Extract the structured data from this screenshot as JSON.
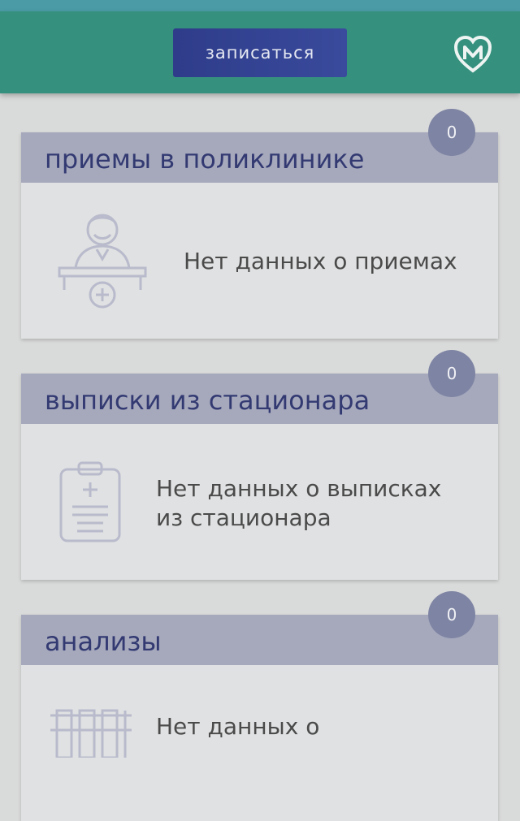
{
  "header": {
    "signup_label": "записаться",
    "logo_icon": "heart-m-logo-icon"
  },
  "cards": [
    {
      "title": "приемы в поликлинике",
      "count": "0",
      "empty_text": "Нет данных о приемах",
      "icon": "receptionist-desk-icon"
    },
    {
      "title": "выписки из стационара",
      "count": "0",
      "empty_text_line1": "Нет данных о выписках",
      "empty_text_line2": "из стационара",
      "icon": "clipboard-icon"
    },
    {
      "title": "анализы",
      "count": "0",
      "empty_text_line1": "Нет данных о",
      "icon": "test-tubes-icon"
    }
  ],
  "colors": {
    "topbar": "#35917e",
    "button": "#2e3c8a",
    "card_header": "#a6a9bc",
    "card_title": "#333a72",
    "badge": "#7e84a3"
  }
}
